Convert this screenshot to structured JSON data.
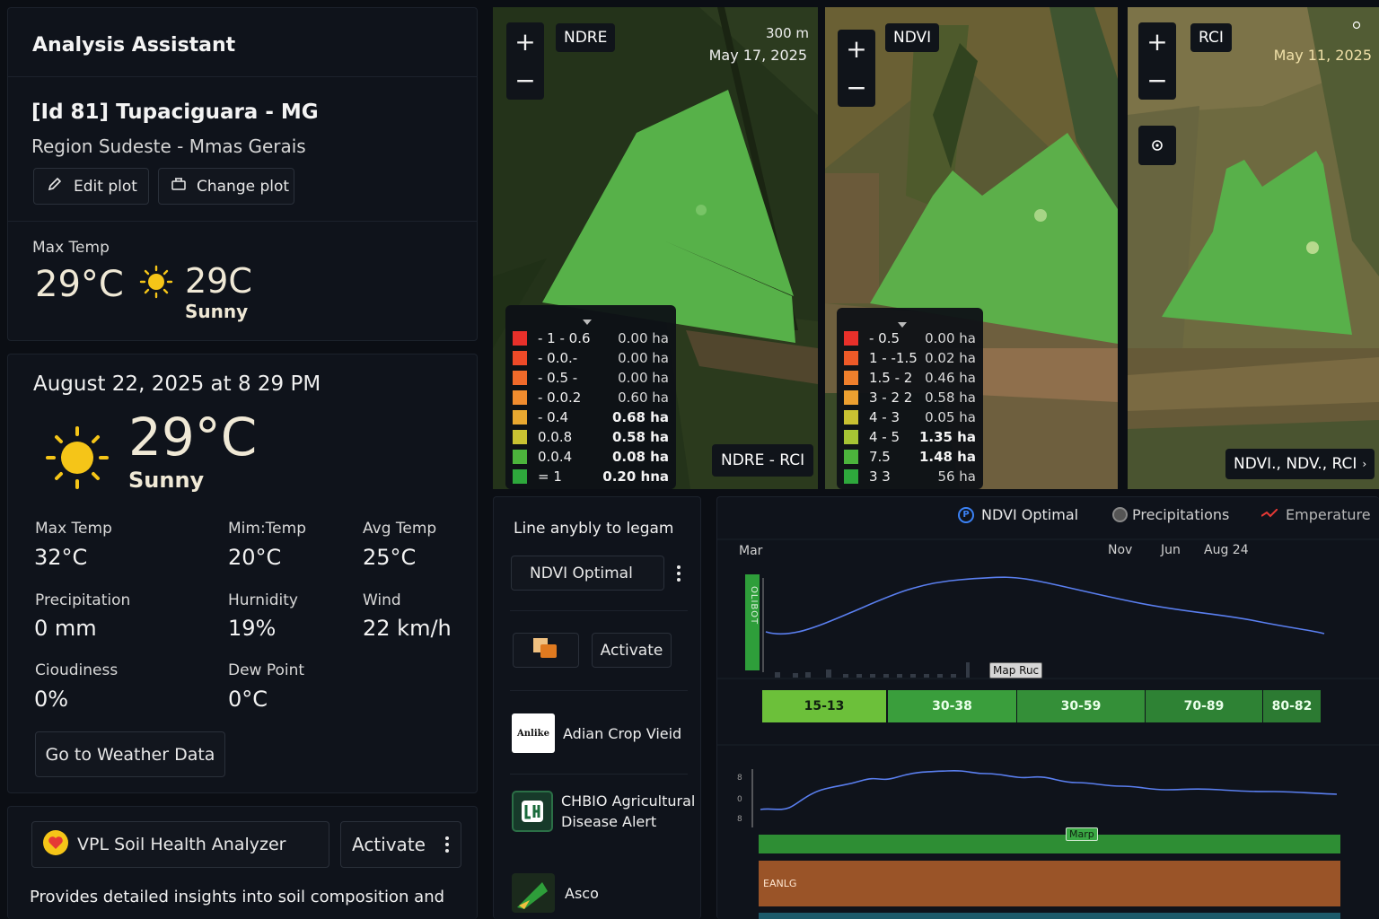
{
  "assistant": {
    "title": "Analysis Assistant",
    "plot_name": "[Id 81] Tupaciguara - MG",
    "region": "Region Sudeste - Mmas Gerais",
    "edit_label": "Edit plot",
    "change_label": "Change plot",
    "max_temp_label": "Max Temp",
    "max_temp": "29°C",
    "forecast_temp": "29C",
    "forecast_cond": "Sunny"
  },
  "weather": {
    "datetime": "August 22, 2025 at 8 29 PM",
    "temp": "29°C",
    "condition": "Sunny",
    "stats": [
      {
        "label": "Max Temp",
        "value": "32°C"
      },
      {
        "label": "Mim:Temp",
        "value": "20°C"
      },
      {
        "label": "Avg Temp",
        "value": "25°C"
      },
      {
        "label": "Precipitation",
        "value": "0 mm"
      },
      {
        "label": "Hurnidity",
        "value": "19%"
      },
      {
        "label": "Wind",
        "value": "22 km/h"
      },
      {
        "label": "Cioudiness",
        "value": "0%"
      },
      {
        "label": "Dew Point",
        "value": "0°C"
      }
    ],
    "go_label": "Go to Weather Data"
  },
  "soil": {
    "name": "VPL Soil Health Analyzer",
    "activate": "Activate",
    "desc": "Provides detailed insights into soil composition and"
  },
  "maps": [
    {
      "index": "NDRE",
      "scale": "300 m",
      "date": "May 17, 2025",
      "badge": "NDRE - RCI",
      "legend": [
        {
          "range": "- 1 - 0.6",
          "area": "0.00 ha",
          "color": "#e8302a"
        },
        {
          "range": "- 0.0.-",
          "area": "0.00 ha",
          "color": "#ee4a28"
        },
        {
          "range": "- 0.5 -",
          "area": "0.00 ha",
          "color": "#f06a2a"
        },
        {
          "range": "- 0.0.2",
          "area": "0.60 ha",
          "color": "#f08c2e"
        },
        {
          "range": "- 0.4",
          "area": "0.68 ha",
          "color": "#e8a830"
        },
        {
          "range": "0.0.8",
          "area": "0.58 ha",
          "color": "#c9c232"
        },
        {
          "range": "0.0.4",
          "area": "0.08 ha",
          "color": "#4cb43c"
        },
        {
          "range": "= 1",
          "area": "0.20 hna",
          "color": "#2ea83c"
        }
      ]
    },
    {
      "index": "NDVI",
      "legend": [
        {
          "range": "- 0.5",
          "area": "0.00 ha",
          "color": "#e8302a"
        },
        {
          "range": "1 - -1.5",
          "area": "0.02 ha",
          "color": "#ee5a28"
        },
        {
          "range": "1.5 - 2",
          "area": "0.46 ha",
          "color": "#f0802c"
        },
        {
          "range": "3 - 2 2",
          "area": "0.58 ha",
          "color": "#eca030"
        },
        {
          "range": "4 - 3",
          "area": "0.05 ha",
          "color": "#c9c232"
        },
        {
          "range": "4 - 5",
          "area": "1.35 ha",
          "color": "#a6c434"
        },
        {
          "range": "7.5",
          "area": "1.48 ha",
          "color": "#4cb43c"
        },
        {
          "range": "3 3",
          "area": "56 ha",
          "color": "#2ea83c"
        }
      ]
    },
    {
      "index": "RCI",
      "date": "May 11, 2025",
      "badge": "NDVI., NDV., RCI"
    }
  ],
  "plugins": {
    "header": "Line anybly to legam",
    "select": "NDVI Optimal",
    "activate": "Activate",
    "items": [
      {
        "label": "Adian Crop Vieid",
        "logo_text": "Anlike"
      },
      {
        "label": "CHBIO Agricultural Disease Alert"
      },
      {
        "label": "Asco"
      }
    ]
  },
  "chart": {
    "legend": [
      {
        "name": "NDVI Optimal",
        "color": "#3b82f6"
      },
      {
        "name": "Precipitations",
        "color": "#888888"
      },
      {
        "name": "Emperature",
        "color": "#e53935"
      }
    ],
    "axis_labels": [
      "Mar",
      "Nov",
      "Jun",
      "Aug 24"
    ],
    "vertical_tag": "OLIBOT",
    "map_tag": "Map Ruc",
    "segments": [
      {
        "label": "15-13",
        "color": "#6cc03a"
      },
      {
        "label": "30-38",
        "color": "#3a9e3c"
      },
      {
        "label": "30-59",
        "color": "#348f38"
      },
      {
        "label": "70-89",
        "color": "#2e8234"
      },
      {
        "label": "80-82",
        "color": "#2c7a32"
      }
    ],
    "y_ticks2": [
      "8",
      "0",
      "8"
    ],
    "marp": "Marp",
    "bar2": "EANLG"
  }
}
